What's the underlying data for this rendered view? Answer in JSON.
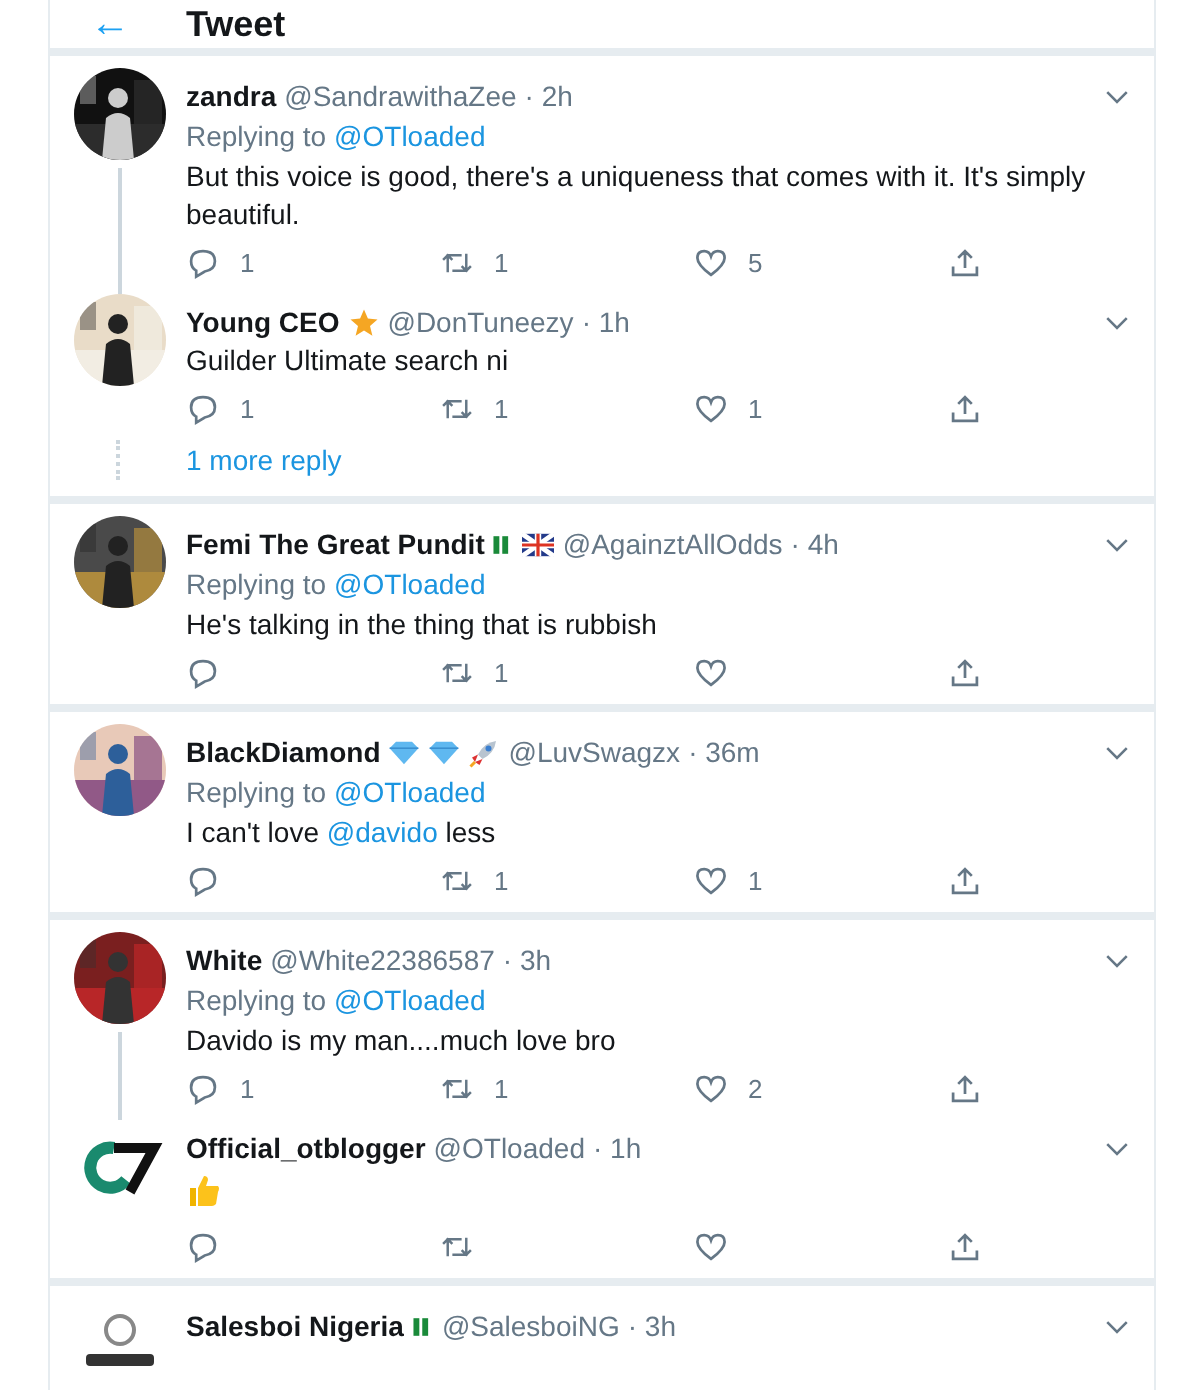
{
  "header": {
    "back": "←",
    "title": "Tweet"
  },
  "groups": [
    {
      "tweets": [
        {
          "name": "zandra",
          "handle": "@SandrawithaZee",
          "time": "· 2h",
          "reply_prefix": "Replying to",
          "reply_to": "@OTloaded",
          "body": "But this voice is good, there's a uniqueness that comes with it. It's simply beautiful.",
          "avatar": {
            "kind": "picture"
          },
          "thread_line": true,
          "replies": "1",
          "retweets": "1",
          "likes": "5"
        },
        {
          "name": "Young CEO",
          "badges": [
            {
              "kind": "star"
            }
          ],
          "handle": "@DonTuneezy",
          "time": "· 1h",
          "body": "Guilder Ultimate search ni",
          "avatar": {
            "kind": "picture"
          },
          "thread_line": false,
          "replies": "1",
          "retweets": "1",
          "likes": "1"
        }
      ],
      "more": "1 more reply"
    },
    {
      "tweets": [
        {
          "name": "Femi The Great Pundit",
          "badges": [
            {
              "kind": "flag-ng"
            },
            {
              "kind": "flag-uk"
            }
          ],
          "handle": "@AgainztAllOdds",
          "time": "· 4h",
          "reply_prefix": "Replying to",
          "reply_to": "@OTloaded",
          "body": "He's talking in the thing that is rubbish",
          "avatar": {
            "kind": "picture"
          },
          "thread_line": false,
          "retweets": "1"
        }
      ]
    },
    {
      "tweets": [
        {
          "name": "BlackDiamond",
          "badges": [
            {
              "kind": "diamond"
            },
            {
              "kind": "diamond"
            },
            {
              "kind": "rocket"
            }
          ],
          "handle": "@LuvSwagzx",
          "time": "· 36m",
          "reply_prefix": "Replying to",
          "reply_to": "@OTloaded",
          "body": "I can't love **@davido** less",
          "avatar": {
            "kind": "picture"
          },
          "thread_line": false,
          "retweets": "1",
          "likes": "1"
        }
      ]
    },
    {
      "tweets": [
        {
          "name": "White",
          "handle": "@White22386587",
          "time": "· 3h",
          "reply_prefix": "Replying to",
          "reply_to": "@OTloaded",
          "body": "Davido is my man....much love bro",
          "avatar": {
            "kind": "picture"
          },
          "thread_line": true,
          "replies": "1",
          "retweets": "1",
          "likes": "2"
        },
        {
          "name": "Official_otblogger",
          "handle": "@OTloaded",
          "time": "· 1h",
          "body_emoji": {
            "kind": "thumbs-up"
          },
          "avatar": {
            "kind": "logo"
          },
          "thread_line": false
        }
      ]
    },
    {
      "tweets": [
        {
          "name": "Salesboi Nigeria",
          "badges": [
            {
              "kind": "flag-ng"
            }
          ],
          "handle": "@SalesboiNG",
          "time": "· 3h",
          "avatar": {
            "kind": "badge-logo"
          },
          "thread_line": false
        }
      ]
    }
  ]
}
